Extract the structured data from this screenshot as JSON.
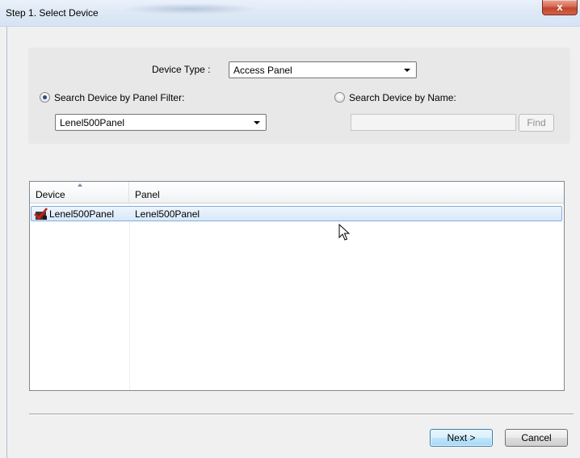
{
  "window": {
    "title": "Step 1. Select Device",
    "close_glyph": "x"
  },
  "filter": {
    "device_type_label": "Device Type :",
    "device_type_value": "Access Panel",
    "search_by_panel_label": "Search Device by Panel Filter:",
    "search_by_panel_selected": true,
    "panel_filter_value": "Lenel500Panel",
    "search_by_name_label": "Search Device by Name:",
    "search_by_name_selected": false,
    "name_value": "",
    "find_label": "Find"
  },
  "list": {
    "columns": [
      "Device",
      "Panel"
    ],
    "sort_column": "Device",
    "rows": [
      {
        "device": "Lenel500Panel",
        "panel": "Lenel500Panel",
        "icon": "access-panel-icon",
        "selected": true
      }
    ]
  },
  "footer": {
    "next_label": "Next >",
    "cancel_label": "Cancel"
  },
  "colors": {
    "selection_border": "#84acdd",
    "selection_fill": "#d6e8fb",
    "close_red": "#c2432b"
  }
}
